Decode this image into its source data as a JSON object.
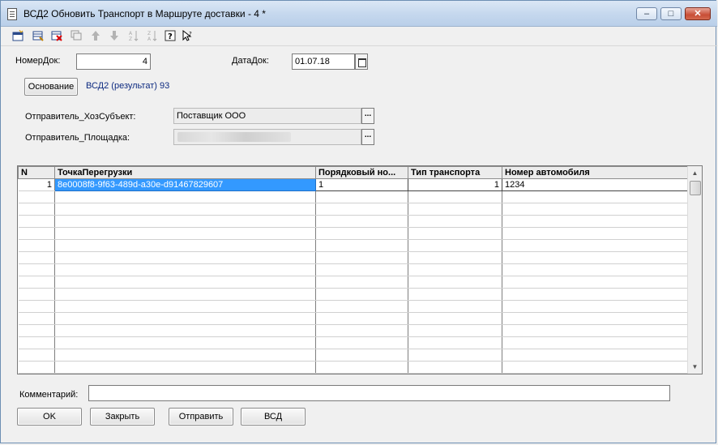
{
  "window": {
    "title": "ВСД2 Обновить Транспорт в Маршруте доставки - 4 *",
    "minimize": "‒",
    "maximize": "□",
    "close": "✕"
  },
  "toolbar": {
    "icons": [
      "add-row-icon",
      "edit-row-icon",
      "delete-row-icon",
      "copy-row-icon",
      "move-up-icon",
      "move-down-icon",
      "sort-asc-icon",
      "sort-desc-icon",
      "help-icon",
      "whats-this-icon"
    ]
  },
  "form": {
    "nomer_label": "НомерДок:",
    "nomer_value": "4",
    "data_label": "ДатаДок:",
    "data_value": "01.07.18",
    "osnovanie_button": "Основание",
    "osnovanie_link": "ВСД2 (результат) 93",
    "sender_label": "Отправитель_ХозСубъект:",
    "sender_value": "Поставщик ООО",
    "site_label": "Отправитель_Площадка:",
    "site_value": "",
    "dots": "...",
    "comment_label": "Комментарий:",
    "comment_value": ""
  },
  "table": {
    "columns": [
      "N",
      "ТочкаПерегрузки",
      "Порядковый но...",
      "Тип транспорта",
      "Номер автомобиля"
    ],
    "rows": [
      [
        "1",
        "8e0008f8-9f63-489d-a30e-d91467829607",
        "1",
        "1",
        "1234"
      ]
    ],
    "empty_rows": 15
  },
  "buttons": {
    "ok": "OK",
    "close": "Закрыть",
    "send": "Отправить",
    "vsd": "ВСД"
  },
  "colors": {
    "selection": "#3399ff",
    "link": "#0d2a80",
    "title_bar": "#c6d8ee"
  }
}
